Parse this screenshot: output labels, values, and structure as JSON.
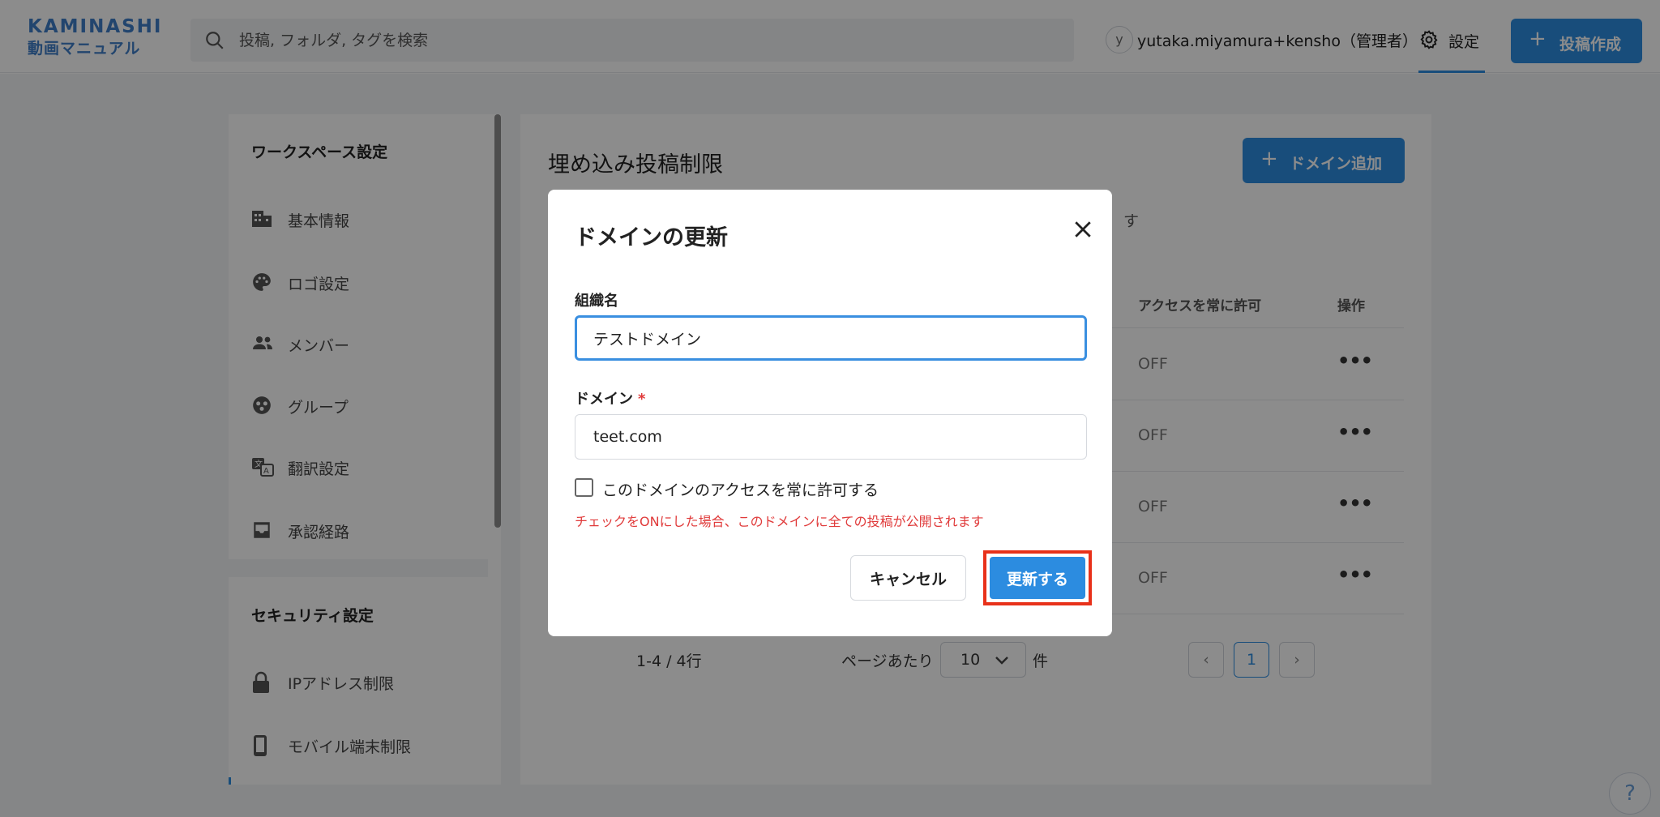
{
  "header": {
    "brand": "KAMINASHI",
    "brand_sub": "動画マニュアル",
    "search_placeholder": "投稿, フォルダ, タグを検索",
    "avatar_letter": "y",
    "username": "yutaka.miyamura+kensho（管理者）",
    "settings_label": "設定",
    "create_label": "投稿作成"
  },
  "sidebar": {
    "workspace_title": "ワークスペース設定",
    "workspace_items": [
      {
        "label": "基本情報",
        "icon": "building-icon"
      },
      {
        "label": "ロゴ設定",
        "icon": "palette-icon"
      },
      {
        "label": "メンバー",
        "icon": "members-icon"
      },
      {
        "label": "グループ",
        "icon": "group-icon"
      },
      {
        "label": "翻訳設定",
        "icon": "translate-icon"
      },
      {
        "label": "承認経路",
        "icon": "inbox-icon"
      }
    ],
    "security_title": "セキュリティ設定",
    "security_items": [
      {
        "label": "IPアドレス制限",
        "icon": "lock-icon"
      },
      {
        "label": "モバイル端末制限",
        "icon": "mobile-icon"
      }
    ]
  },
  "main": {
    "title": "埋め込み投稿制限",
    "desc_tail": "す",
    "add_domain_label": "ドメイン追加",
    "columns": {
      "always_allow": "アクセスを常に許可",
      "actions": "操作"
    },
    "rows": [
      {
        "always_allow": "OFF"
      },
      {
        "always_allow": "OFF"
      },
      {
        "always_allow": "OFF"
      },
      {
        "always_allow": "OFF"
      }
    ],
    "pagination": {
      "count": "1-4 / 4行",
      "per_page_label": "ページあたり",
      "per_page_value": "10",
      "per_page_unit": "件",
      "current_page": "1",
      "prev": "‹",
      "next": "›"
    }
  },
  "modal": {
    "title": "ドメインの更新",
    "org_label": "組織名",
    "org_value": "テストドメイン",
    "domain_label": "ドメイン",
    "domain_required": "*",
    "domain_value": "teet.com",
    "checkbox_label": "このドメインのアクセスを常に許可する",
    "checkbox_checked": false,
    "warning": "チェックをONにした場合、このドメインに全ての投稿が公開されます",
    "cancel_label": "キャンセル",
    "update_label": "更新する"
  },
  "help_label": "?",
  "colors": {
    "accent": "#2c8ce0",
    "danger": "#e03b3b",
    "highlight": "#e8311a"
  }
}
